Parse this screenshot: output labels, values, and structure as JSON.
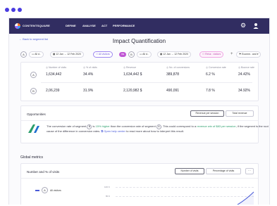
{
  "nav": {
    "brand": "CONTENTSQUARE",
    "items": [
      "DEFINE",
      "ANALYSE",
      "ACT",
      "PERFORMANCE"
    ]
  },
  "page": {
    "back_link": "← Back to segment list",
    "title": "Impact Quantification"
  },
  "filters": {
    "seg_a_circle": "A",
    "seg_a_device": "All d..",
    "seg_a_dates": "12 Jan → 12 Feb 2020",
    "seg_a_segment": "All visitors",
    "vs_label": "VS",
    "seg_b_circle": "B",
    "seg_b_device": "All d..",
    "seg_b_dates": "12 Jan → 12 Feb 2020",
    "seg_b_segment": "Retur.. visitors",
    "add": "+",
    "goal": "Ecomm.. and"
  },
  "metrics": {
    "labels": [
      "Number of visits",
      "% of visits",
      "Revenue",
      "No. of conversions",
      "Conversion rate",
      "Bounce rate"
    ],
    "row_a": {
      "segment": "A",
      "values": [
        "1,634,442",
        "34.4%",
        "1,634,442 $",
        "389,878",
        "6.2 %",
        "24.42%"
      ]
    },
    "row_b": {
      "segment": "B",
      "values": [
        "2,06,239",
        "31.9%",
        "2,120,982 $",
        "490,091",
        "7.8 %",
        "34.92%"
      ]
    }
  },
  "opportunities": {
    "title": "Opportunities",
    "tab_revenue_per_session": "Revenue per session",
    "tab_total_revenue": "Total revenue",
    "text_1": "The conversion rate of segment",
    "seg_b": "B",
    "text_2": "is",
    "highlight_pct": "15% higher",
    "text_3": "than the conversion rate of segment",
    "seg_a": "A",
    "text_4": ". This could correspond to a",
    "highlight_rev": "revenue win of $83 per session",
    "text_5": ", if the segment is the root cause of the difference in conversion rates.",
    "help_link": "Open help center",
    "text_6": "to read more about how to interpret this result."
  },
  "global": {
    "title": "Global metrics",
    "card_title": "Number and % of visits",
    "tab_number": "Number of visits",
    "tab_percentage": "Percentage of visits",
    "more": "···",
    "legend_segment": "A",
    "legend_label": "All visitors",
    "y_ticks": [
      "100 K",
      "80 K"
    ]
  },
  "colors": {
    "nav_bg": "#312d61",
    "accent": "#4a3ce0",
    "segment_a": "#9d86f0",
    "segment_b": "#c050b0",
    "highlight_green": "#2a9d6b"
  }
}
